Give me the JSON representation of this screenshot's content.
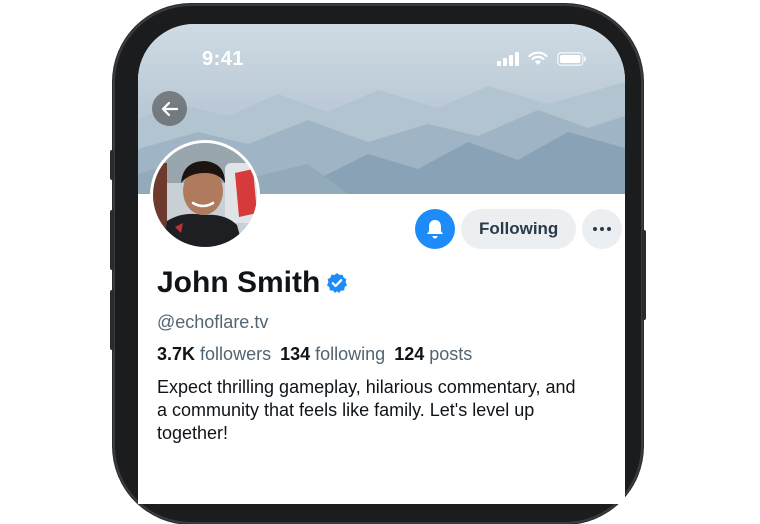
{
  "status_bar": {
    "time": "9:41"
  },
  "profile": {
    "name": "John Smith",
    "handle": "@echoflare.tv",
    "verified": true,
    "stats": {
      "followers_value": "3.7K",
      "followers_label": "followers",
      "following_value": "134",
      "following_label": "following",
      "posts_value": "124",
      "posts_label": "posts"
    },
    "bio": "Expect thrilling gameplay, hilarious commentary, and a community that feels like family. Let's level up together!"
  },
  "actions": {
    "following_label": "Following"
  },
  "colors": {
    "accent": "#1d8cf8",
    "verified": "#1d8cf8",
    "button_bg": "#eceff2",
    "secondary_text": "#536471"
  },
  "icons": [
    "back-arrow-icon",
    "bell-icon",
    "more-icon",
    "verified-badge-icon",
    "signal-icon",
    "wifi-icon",
    "battery-icon"
  ]
}
